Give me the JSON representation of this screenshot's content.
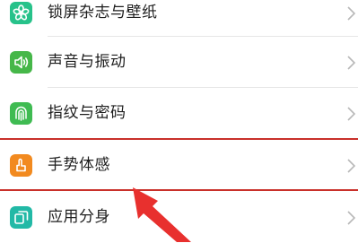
{
  "settings": {
    "items": [
      {
        "label": "锁屏杂志与壁纸",
        "icon": "flower-icon",
        "color": "#27c28a"
      },
      {
        "label": "声音与振动",
        "icon": "speaker-icon",
        "color": "#46b749"
      },
      {
        "label": "指纹与密码",
        "icon": "fingerprint-icon",
        "color": "#3fbb52"
      },
      {
        "label": "手势体感",
        "icon": "hand-gesture-icon",
        "color": "#f28a1f"
      },
      {
        "label": "应用分身",
        "icon": "app-clone-icon",
        "color": "#22b9a6"
      }
    ]
  },
  "annotation": {
    "highlight_color": "#c9302a",
    "arrow_color": "#e8302e"
  }
}
